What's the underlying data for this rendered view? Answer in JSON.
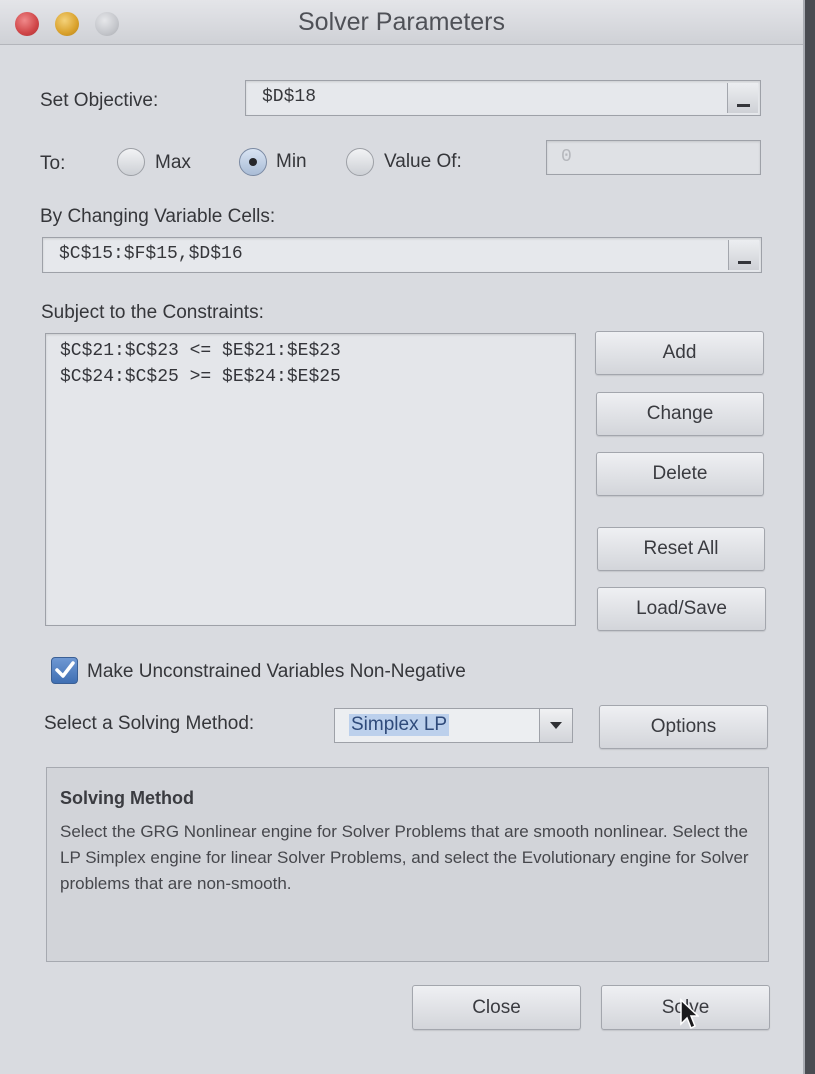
{
  "window": {
    "title": "Solver Parameters"
  },
  "objective": {
    "label": "Set Objective:",
    "value": "$D$18"
  },
  "to": {
    "label": "To:",
    "options": [
      "Max",
      "Min",
      "Value Of:"
    ],
    "selected": "Min",
    "value_of": "0"
  },
  "changing_cells": {
    "label": "By Changing Variable Cells:",
    "value": "$C$15:$F$15,$D$16"
  },
  "constraints": {
    "label": "Subject to the Constraints:",
    "items": [
      "$C$21:$C$23 <= $E$21:$E$23",
      "$C$24:$C$25 >= $E$24:$E$25"
    ],
    "buttons": {
      "add": "Add",
      "change": "Change",
      "delete": "Delete",
      "reset_all": "Reset All",
      "load_save": "Load/Save"
    }
  },
  "nonnegative": {
    "label": "Make Unconstrained Variables Non-Negative",
    "checked": true
  },
  "solving_method": {
    "label": "Select a Solving Method:",
    "value": "Simplex LP",
    "options_button": "Options"
  },
  "method_description": {
    "title": "Solving Method",
    "text": "Select the GRG Nonlinear engine for Solver Problems that are smooth nonlinear. Select the LP Simplex engine for linear Solver Problems, and select the Evolutionary engine for Solver problems that are non-smooth."
  },
  "footer": {
    "close": "Close",
    "solve": "Solve"
  }
}
